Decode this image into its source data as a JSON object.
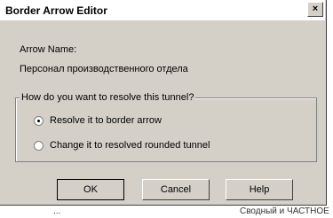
{
  "window": {
    "title": "Border Arrow Editor",
    "close_label": "×"
  },
  "arrow_name": {
    "label": "Arrow Name:",
    "value": "Персонал производственного отдела"
  },
  "tunnel_group": {
    "legend": "How do you want to resolve this tunnel?",
    "options": [
      {
        "label": "Resolve it to border arrow",
        "checked": true
      },
      {
        "label": "Change it to resolved rounded tunnel",
        "checked": false
      }
    ]
  },
  "buttons": {
    "ok": "OK",
    "cancel": "Cancel",
    "help": "Help"
  },
  "background_text": {
    "left": "...",
    "right": "Сводный и ЧАСТНОЕ"
  }
}
